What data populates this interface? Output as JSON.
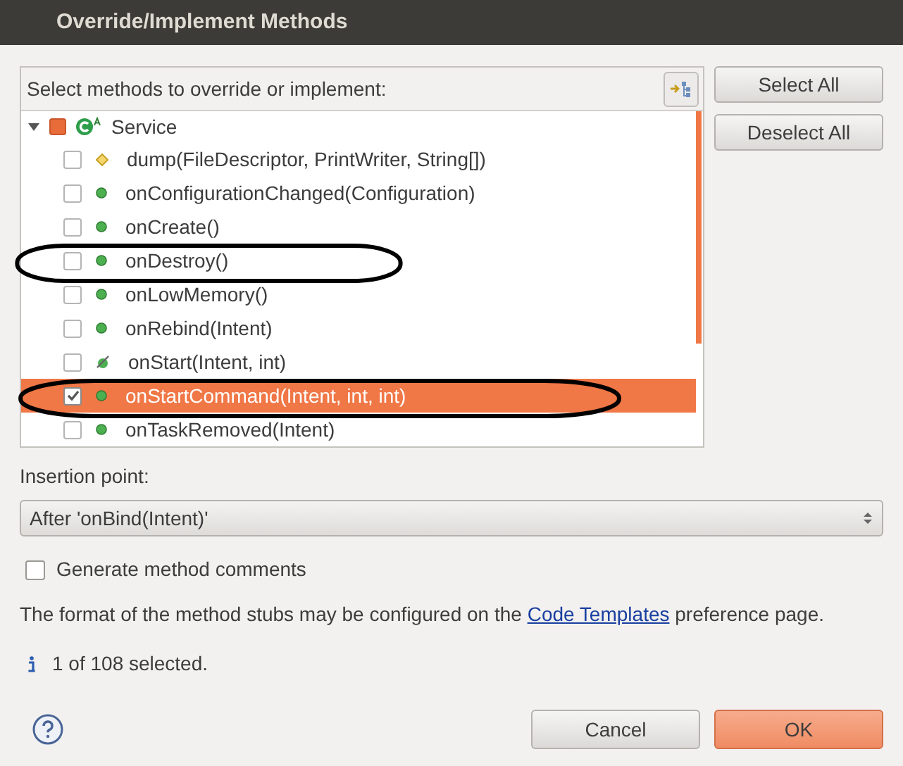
{
  "window": {
    "title": "Override/Implement Methods"
  },
  "methods_panel": {
    "label": "Select methods to override or implement:"
  },
  "tree": {
    "label": "Service",
    "expanded": true,
    "partially_checked": true,
    "children": [
      {
        "label": "dump(FileDescriptor, PrintWriter, String[])",
        "kind": "protected",
        "checked": false,
        "selected": false,
        "circled": false
      },
      {
        "label": "onConfigurationChanged(Configuration)",
        "kind": "public",
        "checked": false,
        "selected": false,
        "circled": false
      },
      {
        "label": "onCreate()",
        "kind": "public",
        "checked": false,
        "selected": false,
        "circled": false
      },
      {
        "label": "onDestroy()",
        "kind": "public",
        "checked": false,
        "selected": false,
        "circled": true
      },
      {
        "label": "onLowMemory()",
        "kind": "public",
        "checked": false,
        "selected": false,
        "circled": false
      },
      {
        "label": "onRebind(Intent)",
        "kind": "public",
        "checked": false,
        "selected": false,
        "circled": false
      },
      {
        "label": "onStart(Intent, int)",
        "kind": "deprecated",
        "checked": false,
        "selected": false,
        "circled": false
      },
      {
        "label": "onStartCommand(Intent, int, int)",
        "kind": "public",
        "checked": true,
        "selected": true,
        "circled": true
      },
      {
        "label": "onTaskRemoved(Intent)",
        "kind": "public",
        "checked": false,
        "selected": false,
        "circled": false
      }
    ]
  },
  "side_buttons": [
    "Select All",
    "Deselect All"
  ],
  "insertion_point": {
    "label": "Insertion point:",
    "value": "After 'onBind(Intent)'"
  },
  "generate_comments": {
    "label": "Generate method comments",
    "checked": false
  },
  "description": {
    "before": "The format of the method stubs may be configured on the",
    "link": "Code Templates",
    "after": "preference page."
  },
  "status": {
    "text": "1 of 108 selected."
  },
  "buttons": [
    {
      "label": "Cancel",
      "kind": "normal"
    },
    {
      "label": "OK",
      "kind": "default"
    }
  ]
}
